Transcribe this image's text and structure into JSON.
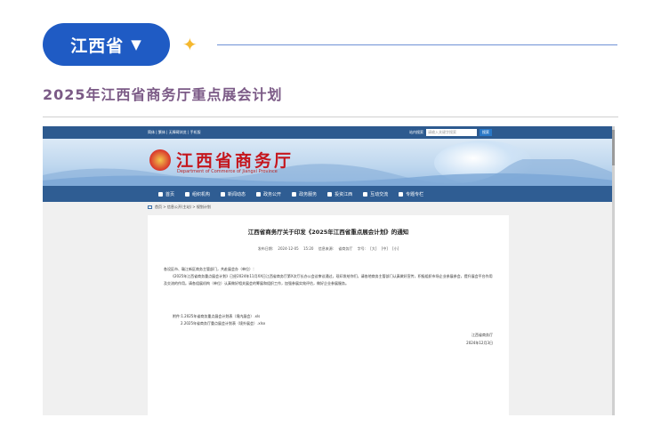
{
  "header": {
    "province_label": "江西省",
    "caret": "▼",
    "sparkle": "✦",
    "headline": "2025年江西省商务厅重点展会计划"
  },
  "site": {
    "topbar": {
      "links": "简体 | 繁体 | 无障碍浏览 | 手机版",
      "search_label": "站内搜索",
      "search_placeholder": "请输入关键字搜索",
      "search_button": "搜索"
    },
    "banner": {
      "title": "江西省商务厅",
      "subtitle": "Department of Commerce of Jiangxi Province"
    },
    "nav": [
      "首页",
      "组织机构",
      "新闻动态",
      "政务公开",
      "政务服务",
      "投资江西",
      "互动交流",
      "专题专栏"
    ],
    "breadcrumb": "首页 > 信息公开(主站) > 规划计划",
    "article": {
      "title": "江西省商务厅关于印发《2025年江西省重点展会计划》的通知",
      "meta": "发布日期: 2024-12-05 15:20   信息来源: 省商务厅   字号: [大] [中] [小]",
      "salutation": "各设区市、赣江新区商务主管部门，共赴展会办（单位）：",
      "paragraph": "《2025年江西省商务重点展会计划》已经2024年11月XX日江西省商务厅第X次厅长办公会议审议通过，现印发给你们，请各地商务主管部门认真做好宣传，积极组织市场企业参展参会，提升展会平台作用及交流的作用。请各组展机构（单位）认真做好相关展会的筹展和组织工作，加强参展实效评估，做好企业参展服务。",
      "attachments": [
        "附件:1.2025年省商务重点展会计划表（境内展会）.xls",
        "2.2025年省商务厅重点展会计划表（境外展会）.xlsx"
      ],
      "signer": "江西省商务厅",
      "date": "2024年12月3日"
    }
  }
}
